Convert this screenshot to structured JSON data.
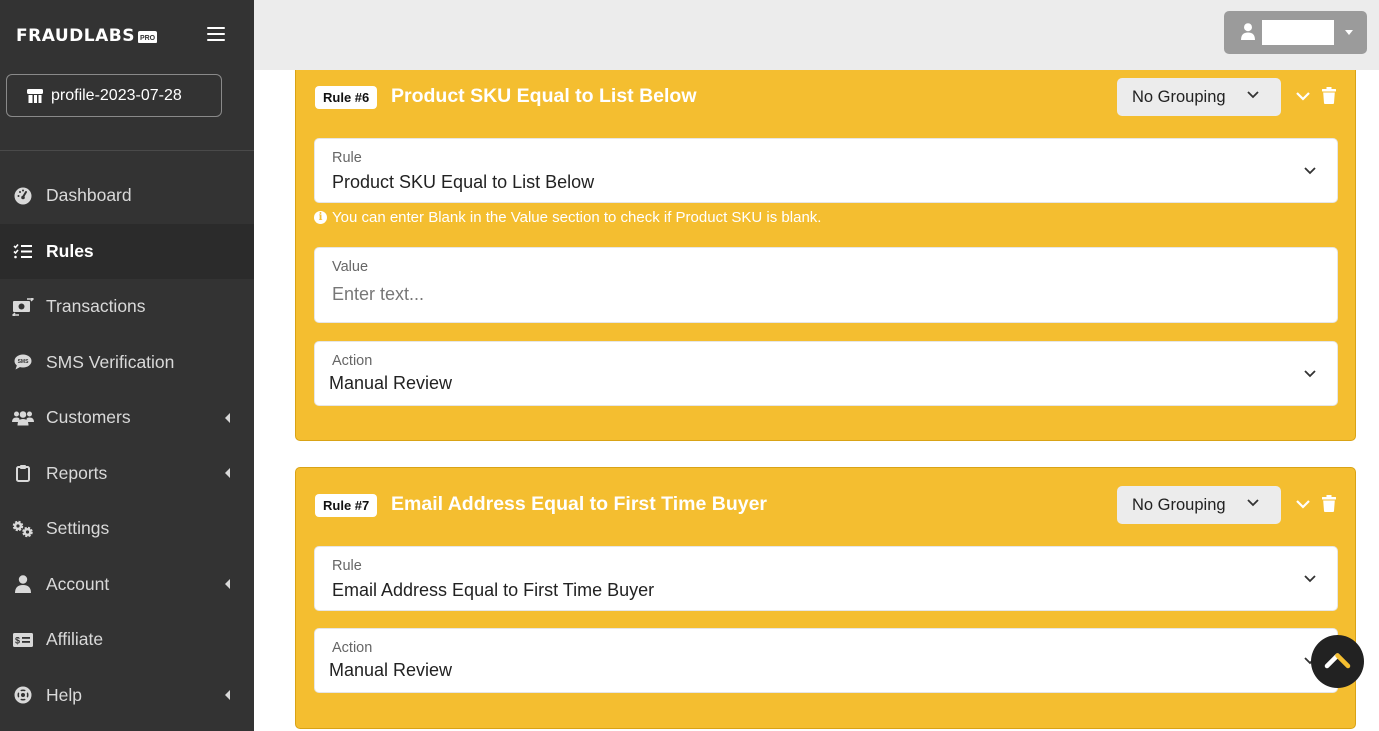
{
  "brand": {
    "name": "FRAUDLABS",
    "badge": "PRO"
  },
  "sidebar": {
    "profile_label": "profile-2023-07-28",
    "items": [
      {
        "label": "Dashboard",
        "icon": "tachometer-icon",
        "active": false,
        "has_submenu": false
      },
      {
        "label": "Rules",
        "icon": "checklist-icon",
        "active": true,
        "has_submenu": false
      },
      {
        "label": "Transactions",
        "icon": "money-exchange-icon",
        "active": false,
        "has_submenu": false
      },
      {
        "label": "SMS Verification",
        "icon": "sms-icon",
        "active": false,
        "has_submenu": false
      },
      {
        "label": "Customers",
        "icon": "users-icon",
        "active": false,
        "has_submenu": true
      },
      {
        "label": "Reports",
        "icon": "clipboard-icon",
        "active": false,
        "has_submenu": true
      },
      {
        "label": "Settings",
        "icon": "gears-icon",
        "active": false,
        "has_submenu": false
      },
      {
        "label": "Account",
        "icon": "user-icon",
        "active": false,
        "has_submenu": true
      },
      {
        "label": "Affiliate",
        "icon": "money-check-icon",
        "active": false,
        "has_submenu": false
      },
      {
        "label": "Help",
        "icon": "life-ring-icon",
        "active": false,
        "has_submenu": true
      }
    ]
  },
  "topbar": {
    "user_name": ""
  },
  "rules": [
    {
      "badge": "Rule #6",
      "title": "Product SKU Equal to List Below",
      "grouping": "No Grouping",
      "rule_label": "Rule",
      "rule_value": "Product SKU Equal to List Below",
      "hint": "You can enter Blank in the Value section to check if Product SKU is blank.",
      "value_label": "Value",
      "value_placeholder": "Enter text...",
      "action_label": "Action",
      "action_value": "Manual Review"
    },
    {
      "badge": "Rule #7",
      "title": "Email Address Equal to First Time Buyer",
      "grouping": "No Grouping",
      "rule_label": "Rule",
      "rule_value": "Email Address Equal to First Time Buyer",
      "action_label": "Action",
      "action_value": "Manual Review"
    }
  ],
  "colors": {
    "accent": "#f4be30",
    "sidebar_bg": "#333333",
    "topbar_bg": "#ececec"
  }
}
